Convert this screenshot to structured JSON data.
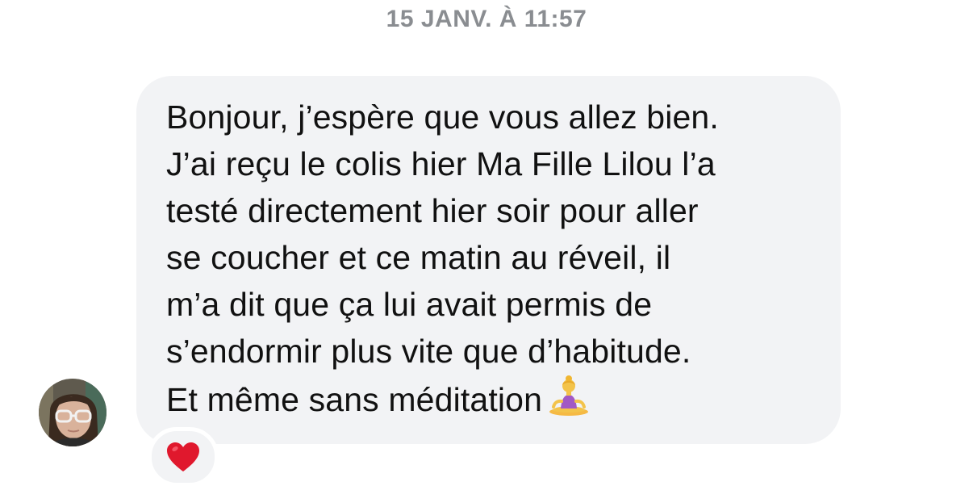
{
  "conversation": {
    "timestamp": "15 JANV. À 11:57"
  },
  "message": {
    "sender_avatar_icon": "user-avatar-photo",
    "text": "Bonjour, j’espère que vous allez bien.\nJ’ai reçu le colis hier Ma Fille Lilou l’a\ntesté directement hier soir pour aller\nse coucher et ce matin au réveil, il\nm’a dit que ça lui avait permis de\ns’endormir plus vite que d’habitude.\nEt même sans méditation",
    "emoji_icon": "person-in-lotus-position-emoji",
    "bubble_color": "#f2f3f5"
  },
  "reaction": {
    "icon": "red-heart-icon",
    "color": "#e0182d"
  }
}
